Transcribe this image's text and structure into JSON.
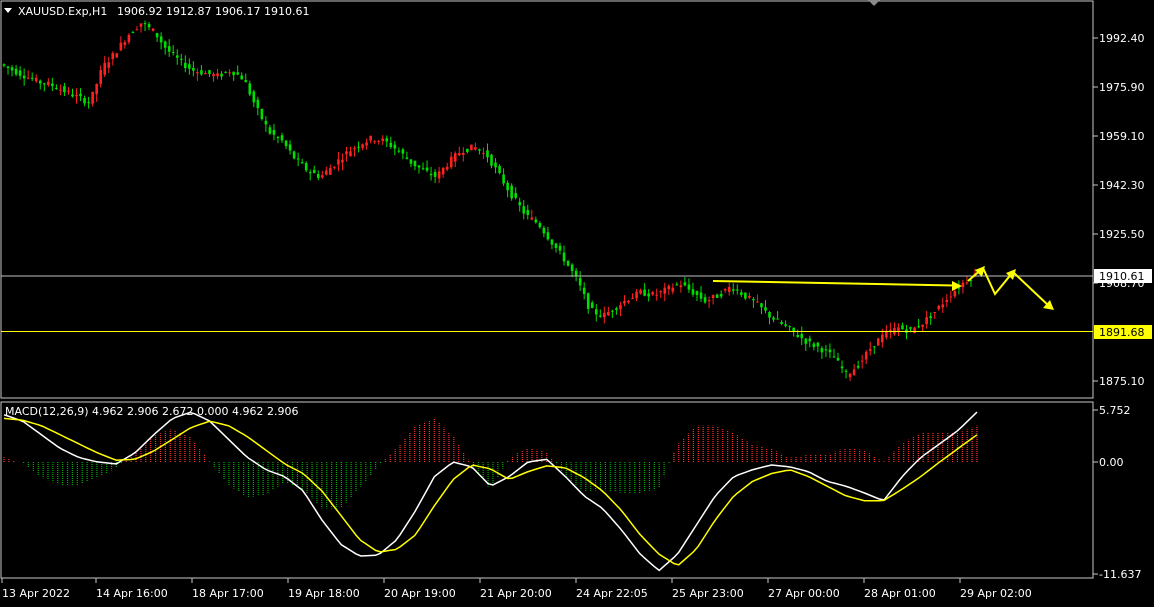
{
  "header": {
    "symbol": "XAUUSD.Exp,H1",
    "ohlc": "1906.92 1912.87 1906.17 1910.61",
    "dropdown_icon": "triangle-down-icon"
  },
  "price_axis": {
    "ticks": [
      "1992.40",
      "1975.90",
      "1959.10",
      "1942.30",
      "1925.50",
      "1908.70",
      "1875.10"
    ],
    "current_price_label": "1910.61",
    "level_label": "1891.68",
    "level_color": "#ffff00",
    "bid_line_color": "#c0c0c0"
  },
  "macd": {
    "title": "MACD(12,26,9) 4.962 2.906 2.672 0.000 4.962 2.906",
    "ticks": [
      "5.752",
      "0.00",
      "-11.637"
    ]
  },
  "time_axis": {
    "labels": [
      "13 Apr 2022",
      "14 Apr 16:00",
      "18 Apr 17:00",
      "19 Apr 18:00",
      "20 Apr 19:00",
      "21 Apr 20:00",
      "24 Apr 22:05",
      "25 Apr 23:00",
      "27 Apr 00:00",
      "28 Apr 01:00",
      "29 Apr 02:00"
    ]
  },
  "colors": {
    "background": "#000000",
    "bull_candle": "#ff2020",
    "bear_candle": "#00e000",
    "annotation": "#ffff00",
    "macd_main": "#ffffff",
    "macd_signal": "#ffff00",
    "hist_positive": "#ff3030",
    "hist_negative": "#00b000"
  },
  "chart_data": {
    "type": "candlestick",
    "symbol": "XAUUSD.Exp",
    "timeframe": "H1",
    "price_range": [
      1869,
      2002
    ],
    "level_1891_68": 1891.68,
    "current_price": 1910.61,
    "price_path": [
      1981,
      1979,
      1977,
      1975,
      1974,
      1972,
      1970,
      1968,
      1980,
      1985,
      1991,
      1995,
      1992,
      1986,
      1982,
      1979,
      1978,
      1977,
      1979,
      1976,
      1966,
      1958,
      1955,
      1949,
      1945,
      1943,
      1947,
      1951,
      1954,
      1956,
      1955,
      1952,
      1948,
      1945,
      1943,
      1948,
      1952,
      1953,
      1950,
      1943,
      1936,
      1930,
      1927,
      1921,
      1915,
      1908,
      1898,
      1896,
      1899,
      1902,
      1904,
      1903,
      1905,
      1907,
      1904,
      1901,
      1903,
      1906,
      1903,
      1900,
      1896,
      1893,
      1890,
      1887,
      1885,
      1882,
      1876,
      1880,
      1886,
      1890,
      1892,
      1891,
      1894,
      1898,
      1903,
      1907,
      1910
    ],
    "macd_main_path": [
      5.2,
      4.5,
      3.0,
      1.5,
      0.5,
      0.0,
      -0.2,
      1.0,
      3.0,
      4.8,
      5.5,
      4.5,
      2.5,
      0.5,
      -0.8,
      -1.5,
      -3.0,
      -6.0,
      -8.5,
      -9.7,
      -9.6,
      -8.0,
      -5.0,
      -1.5,
      0.0,
      -0.5,
      -2.5,
      -1.5,
      0.0,
      0.3,
      -1.5,
      -3.5,
      -4.8,
      -7.0,
      -9.5,
      -11.2,
      -9.5,
      -6.5,
      -3.5,
      -1.5,
      -0.8,
      -0.3,
      -0.5,
      -1.0,
      -2.0,
      -2.5,
      -3.2,
      -4.0,
      -1.5,
      0.5,
      2.0,
      3.5,
      5.5
    ],
    "macd_signal_path": [
      4.8,
      4.6,
      4.0,
      3.0,
      2.0,
      1.0,
      0.2,
      0.3,
      1.2,
      2.5,
      3.8,
      4.5,
      4.0,
      2.8,
      1.3,
      -0.2,
      -1.2,
      -3.0,
      -5.5,
      -8.0,
      -9.3,
      -9.0,
      -7.5,
      -4.5,
      -1.8,
      -0.3,
      -0.7,
      -1.8,
      -1.0,
      -0.4,
      -0.6,
      -1.6,
      -3.0,
      -5.0,
      -7.5,
      -9.5,
      -10.7,
      -9.0,
      -6.0,
      -3.5,
      -2.0,
      -1.2,
      -0.8,
      -1.5,
      -2.5,
      -3.5,
      -4.0,
      -4.0,
      -2.8,
      -1.5,
      0.0,
      1.5,
      3.0
    ],
    "annotations": [
      {
        "type": "horizontal-level",
        "price": 1891.68
      },
      {
        "type": "trend-arrow",
        "from": 1910,
        "to": 1908
      },
      {
        "type": "projection-zigzag",
        "path": [
          1909,
          1913,
          1903,
          1912,
          1898
        ]
      }
    ]
  }
}
